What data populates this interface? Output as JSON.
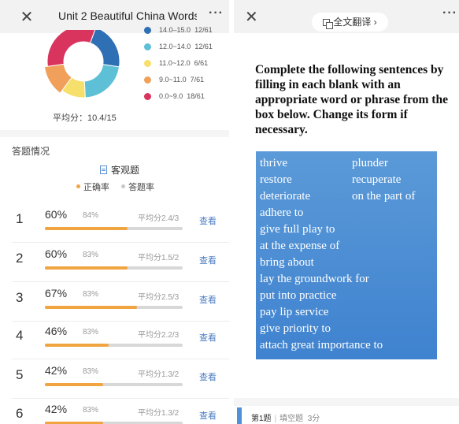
{
  "left": {
    "header": {
      "close": "✕",
      "title": "Unit 2 Beautiful China Words",
      "more": "···"
    },
    "score_legend": [
      {
        "label": "14.0–15.0",
        "count": "12/61",
        "color": "#2f6fb3"
      },
      {
        "label": "12.0~14.0",
        "count": "12/61",
        "color": "#5ec0d6"
      },
      {
        "label": "11.0~12.0",
        "count": "6/61",
        "color": "#f7df6b"
      },
      {
        "label": "9.0~11.0",
        "count": "7/61",
        "color": "#f0a05a"
      },
      {
        "label": "0.0~9.0",
        "count": "18/61",
        "color": "#d9345e"
      }
    ],
    "average": "平均分：10.4/15",
    "section_title": "答题情况",
    "subtitle": "客观题",
    "key_correct": "正确率",
    "key_answer": "答题率",
    "key_correct_color": "#f0a540",
    "key_answer_color": "#c8c8c8",
    "view_label": "查看",
    "questions": [
      {
        "num": "1",
        "correct": "60%",
        "answer_rate": "84%",
        "avg": "平均分2.4/3",
        "fill": 0.6
      },
      {
        "num": "2",
        "correct": "60%",
        "answer_rate": "83%",
        "avg": "平均分1.5/2",
        "fill": 0.6
      },
      {
        "num": "3",
        "correct": "67%",
        "answer_rate": "83%",
        "avg": "平均分2.5/3",
        "fill": 0.67
      },
      {
        "num": "4",
        "correct": "46%",
        "answer_rate": "83%",
        "avg": "平均分2.2/3",
        "fill": 0.46
      },
      {
        "num": "5",
        "correct": "42%",
        "answer_rate": "83%",
        "avg": "平均分1.3/2",
        "fill": 0.42
      },
      {
        "num": "6",
        "correct": "42%",
        "answer_rate": "83%",
        "avg": "平均分1.3/2",
        "fill": 0.42
      }
    ]
  },
  "right": {
    "header": {
      "close": "✕",
      "translate": "全文翻译 ›",
      "more": "···"
    },
    "instructions": "Complete the following sentences by filling in each blank with an appropriate word or phrase from the box below. Change its form if necessary.",
    "words": [
      "thrive",
      "plunder",
      "restore",
      "recuperate",
      "deteriorate",
      "on the part of",
      "adhere to",
      "give full play to",
      "at the expense of",
      "bring about",
      "lay the groundwork for",
      "put into practice",
      "pay lip service",
      "give priority to",
      "attach great importance to"
    ],
    "footer": {
      "question": "第1题",
      "type": "填空题",
      "points": "3分"
    }
  }
}
